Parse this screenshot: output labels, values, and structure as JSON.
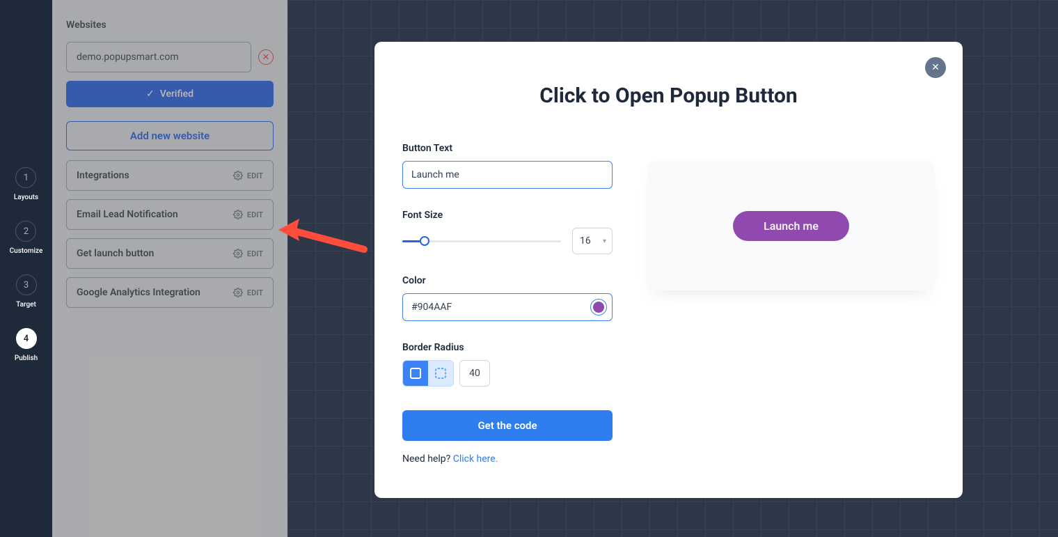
{
  "nav": {
    "steps": [
      {
        "num": "1",
        "label": "Layouts",
        "active": false
      },
      {
        "num": "2",
        "label": "Customize",
        "active": false
      },
      {
        "num": "3",
        "label": "Target",
        "active": false
      },
      {
        "num": "4",
        "label": "Publish",
        "active": true
      }
    ]
  },
  "sidebar": {
    "section_title": "Websites",
    "website_value": "demo.popupsmart.com",
    "verified_label": "Verified",
    "add_label": "Add new website",
    "edit_label": "EDIT",
    "rows": [
      {
        "label": "Integrations"
      },
      {
        "label": "Email Lead Notification"
      },
      {
        "label": "Get launch button"
      },
      {
        "label": "Google Analytics Integration"
      }
    ]
  },
  "modal": {
    "title": "Click to Open Popup Button",
    "fields": {
      "button_text_label": "Button Text",
      "button_text_value": "Launch me",
      "font_size_label": "Font Size",
      "font_size_value": "16",
      "color_label": "Color",
      "color_value": "#904AAF",
      "border_radius_label": "Border Radius",
      "border_radius_value": "40"
    },
    "get_code_label": "Get the code",
    "help_text": "Need help? ",
    "help_link": "Click here.",
    "preview_button_label": "Launch me"
  }
}
